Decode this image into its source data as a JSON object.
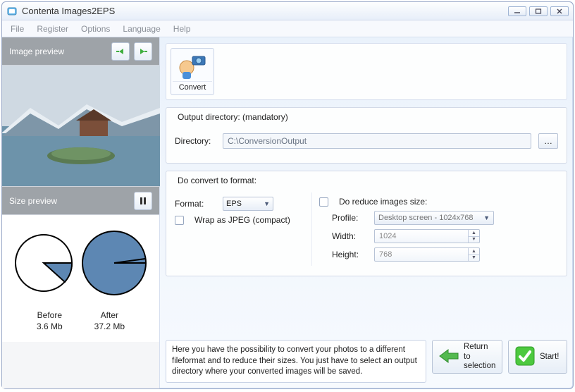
{
  "window": {
    "title": "Contenta Images2EPS"
  },
  "menu": {
    "file": "File",
    "register": "Register",
    "options": "Options",
    "language": "Language",
    "help": "Help"
  },
  "left": {
    "preview_title": "Image preview",
    "size_title": "Size preview",
    "before_label": "Before",
    "before_value": "3.6 Mb",
    "after_label": "After",
    "after_value": "37.2 Mb"
  },
  "convert": {
    "label": "Convert"
  },
  "output": {
    "legend": "Output directory: (mandatory)",
    "dir_label": "Directory:",
    "directory": "C:\\ConversionOutput",
    "browse_label": "…"
  },
  "format": {
    "legend": "Do convert to format:",
    "format_label": "Format:",
    "format_value": "EPS",
    "wrap_label": "Wrap as JPEG (compact)",
    "reduce_label": "Do reduce images size:",
    "profile_label": "Profile:",
    "profile_value": "Desktop screen - 1024x768",
    "width_label": "Width:",
    "width_value": "1024",
    "height_label": "Height:",
    "height_value": "768"
  },
  "help_text": "Here you have the possibility to convert your photos to a different fileformat and to reduce their sizes. You just have to select an output directory where your converted images will be saved.",
  "buttons": {
    "return_line1": "Return",
    "return_line2": "to selection",
    "start": "Start!"
  }
}
